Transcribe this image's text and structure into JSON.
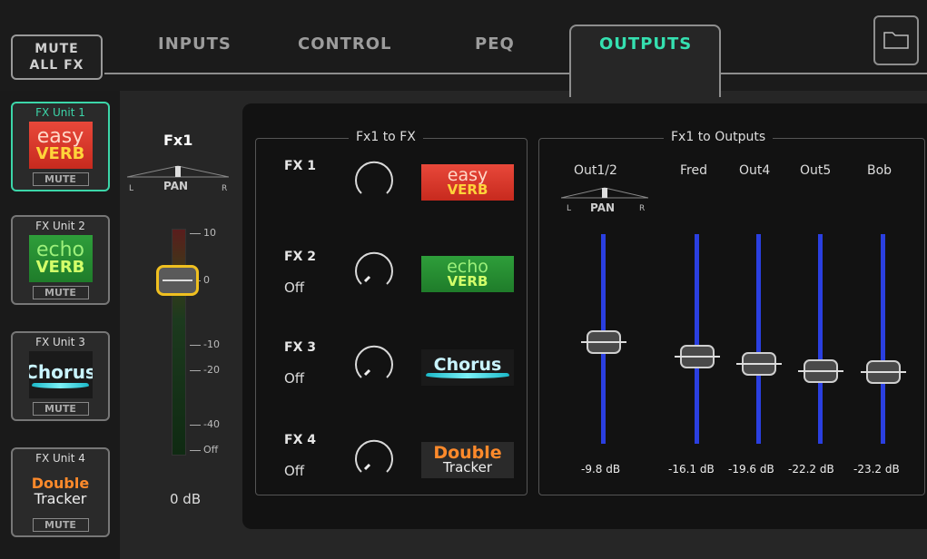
{
  "header": {
    "mute_all_line1": "MUTE",
    "mute_all_line2": "ALL FX",
    "tabs": [
      {
        "label": "INPUTS"
      },
      {
        "label": "CONTROL"
      },
      {
        "label": "PEQ"
      },
      {
        "label": "OUTPUTS"
      }
    ],
    "active_tab": "OUTPUTS",
    "folder_icon": "folder-icon",
    "accent_color": "#35e0b0"
  },
  "fx_units": [
    {
      "name": "FX Unit 1",
      "logo_l1": "easy",
      "logo_l2": "VERB",
      "mute": "MUTE",
      "selected": true
    },
    {
      "name": "FX Unit 2",
      "logo_l1": "echo",
      "logo_l2": "VERB",
      "mute": "MUTE"
    },
    {
      "name": "FX Unit 3",
      "logo_l1": "Chorus",
      "logo_l2": "",
      "mute": "MUTE"
    },
    {
      "name": "FX Unit 4",
      "logo_l1": "Double",
      "logo_l2": "Tracker",
      "mute": "MUTE"
    }
  ],
  "fx1": {
    "title": "Fx1",
    "pan_label": "PAN",
    "pan_l": "L",
    "pan_r": "R",
    "scale": [
      "10",
      "0",
      "-10",
      "-20",
      "-40",
      "Off"
    ],
    "level": "0 dB"
  },
  "fx_sends": {
    "title": "Fx1 to FX",
    "rows": [
      {
        "label": "FX 1",
        "state": ""
      },
      {
        "label": "FX 2",
        "state": "Off"
      },
      {
        "label": "FX 3",
        "state": "Off"
      },
      {
        "label": "FX 4",
        "state": "Off"
      }
    ]
  },
  "outputs": {
    "title": "Fx1 to Outputs",
    "pan_label": "PAN",
    "pan_l": "L",
    "pan_r": "R",
    "channels": [
      {
        "name": "Out1/2",
        "db": "-9.8 dB"
      },
      {
        "name": "Fred",
        "db": "-16.1 dB"
      },
      {
        "name": "Out4",
        "db": "-19.6 dB"
      },
      {
        "name": "Out5",
        "db": "-22.2 dB"
      },
      {
        "name": "Bob",
        "db": "-23.2 dB"
      }
    ],
    "track_color": "#2a3fe0"
  }
}
